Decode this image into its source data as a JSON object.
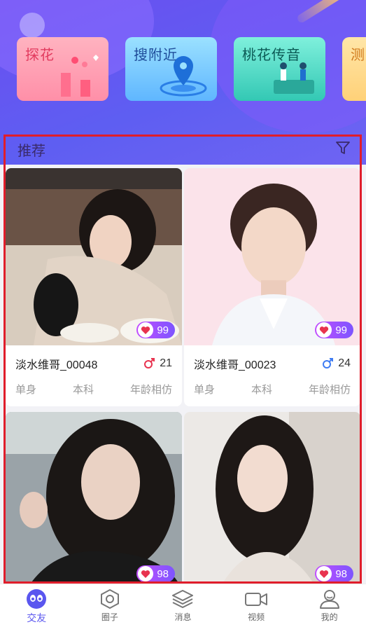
{
  "features": [
    {
      "title": "探花",
      "icon": "tower-heart-illustration"
    },
    {
      "title": "搜附近",
      "icon": "location-pin-illustration"
    },
    {
      "title": "桃花传音",
      "icon": "couple-chat-illustration"
    },
    {
      "title": "测爱",
      "icon": "test-illustration"
    }
  ],
  "recommend": {
    "title": "推荐",
    "filter_icon": "filter-icon"
  },
  "profiles": [
    {
      "name": "淡水维哥_00048",
      "gender": "female",
      "age": "21",
      "likes": "99",
      "status": "单身",
      "education": "本科",
      "age_match": "年龄相仿"
    },
    {
      "name": "淡水维哥_00023",
      "gender": "male",
      "age": "24",
      "likes": "99",
      "status": "单身",
      "education": "本科",
      "age_match": "年龄相仿"
    },
    {
      "name": "",
      "likes": "98"
    },
    {
      "name": "",
      "likes": "98"
    }
  ],
  "nav": [
    {
      "label": "交友",
      "icon": "friends-icon",
      "active": true
    },
    {
      "label": "圈子",
      "icon": "circle-hexagon-icon",
      "active": false
    },
    {
      "label": "消息",
      "icon": "layers-message-icon",
      "active": false
    },
    {
      "label": "视频",
      "icon": "video-camera-icon",
      "active": false
    },
    {
      "label": "我的",
      "icon": "profile-icon",
      "active": false
    }
  ],
  "colors": {
    "accent": "#5a56ef",
    "female": "#e8334f",
    "male": "#3f7cf2",
    "highlight": "#e01d2b"
  }
}
